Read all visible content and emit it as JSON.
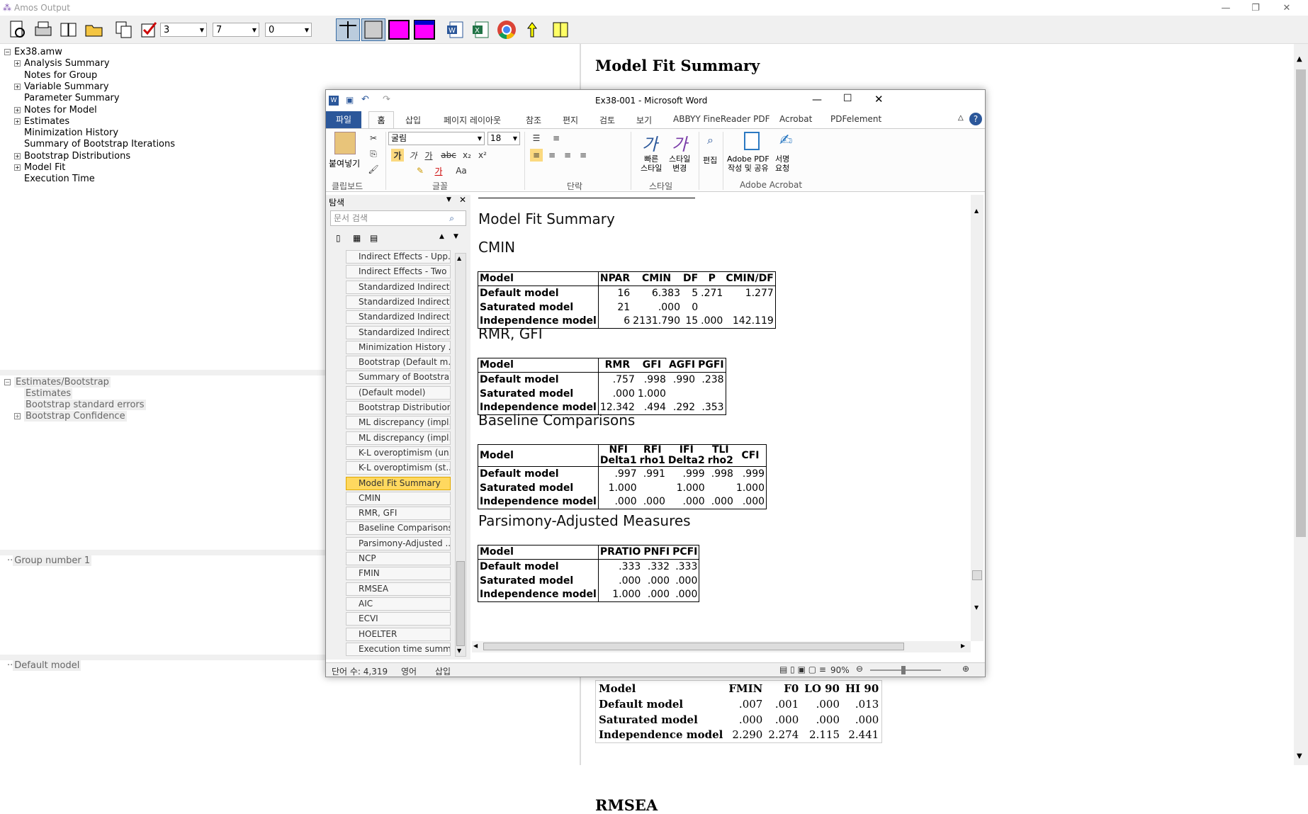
{
  "amos": {
    "title": "Amos Output",
    "window_buttons": [
      "—",
      "❐",
      "✕"
    ],
    "selects": [
      "3",
      "7",
      "0"
    ],
    "tree": [
      {
        "label": "Ex38.amw",
        "pm": "−",
        "indent": 0
      },
      {
        "label": "Analysis Summary",
        "pm": "+",
        "indent": 1
      },
      {
        "label": "Notes for Group",
        "pm": "",
        "indent": 1
      },
      {
        "label": "Variable Summary",
        "pm": "+",
        "indent": 1
      },
      {
        "label": "Parameter Summary",
        "pm": "",
        "indent": 1
      },
      {
        "label": "Notes for Model",
        "pm": "+",
        "indent": 1
      },
      {
        "label": "Estimates",
        "pm": "+",
        "indent": 1
      },
      {
        "label": "Minimization History",
        "pm": "",
        "indent": 1
      },
      {
        "label": "Summary of Bootstrap Iterations",
        "pm": "",
        "indent": 1
      },
      {
        "label": "Bootstrap Distributions",
        "pm": "+",
        "indent": 1
      },
      {
        "label": "Model Fit",
        "pm": "+",
        "indent": 1
      },
      {
        "label": "Execution Time",
        "pm": "",
        "indent": 1
      }
    ],
    "pane2": {
      "root": "Estimates/Bootstrap",
      "items": [
        "Estimates",
        "Bootstrap standard errors",
        "Bootstrap Confidence"
      ]
    },
    "pane3": "Group number 1",
    "pane4": "Default model",
    "output_heading": "Model Fit Summary",
    "output_next_heading": "RMSEA",
    "fmin_table": {
      "header": [
        "Model",
        "FMIN",
        "F0",
        "LO 90",
        "HI 90"
      ],
      "rows": [
        [
          "Default model",
          ".007",
          ".001",
          ".000",
          ".013"
        ],
        [
          "Saturated model",
          ".000",
          ".000",
          ".000",
          ".000"
        ],
        [
          "Independence model",
          "2.290",
          "2.274",
          "2.115",
          "2.441"
        ]
      ]
    }
  },
  "word": {
    "title": "Ex38-001  -  Microsoft Word",
    "tabs": [
      "파일",
      "홈",
      "삽입",
      "페이지 레이아웃",
      "참조",
      "편지",
      "검토",
      "보기",
      "ABBYY FineReader PDF",
      "Acrobat",
      "PDFelement"
    ],
    "font_name": "굴림",
    "font_size": "18",
    "groups": [
      "클립보드",
      "글꼴",
      "단락",
      "스타일",
      "Adobe Acrobat"
    ],
    "paste_label": "붙여넣기",
    "style_quick": "빠른\n스타일",
    "style_change": "스타일\n변경",
    "edit_label": "편집",
    "adobe_pdf": "Adobe PDF\n작성 및 공유",
    "sign_req": "서명\n요청",
    "nav_title": "탐색",
    "nav_search_placeholder": "문서 검색",
    "nav_items": [
      "Indirect Effects - Upp...",
      "Indirect Effects - Two ...",
      "Standardized Indirect ...",
      "Standardized Indirect ...",
      "Standardized Indirect ...",
      "Standardized Indirect ...",
      "Minimization History ...",
      "Bootstrap (Default m...",
      "Summary of Bootstra...",
      "(Default model)",
      "Bootstrap Distribution...",
      "ML discrepancy (impl...",
      "ML discrepancy (impl...",
      "K-L overoptimism (un...",
      "K-L overoptimism (st...",
      "Model Fit Summary",
      "CMIN",
      "RMR, GFI",
      "Baseline Comparisons",
      "Parsimony-Adjusted ...",
      "NCP",
      "FMIN",
      "RMSEA",
      "AIC",
      "ECVI",
      "HOELTER",
      "Execution time summ..."
    ],
    "nav_selected": 15,
    "doc": {
      "title": "Model Fit Summary",
      "cmin": {
        "heading": "CMIN",
        "header": [
          "Model",
          "NPAR",
          "CMIN",
          "DF",
          "P",
          "CMIN/DF"
        ],
        "rows": [
          [
            "Default model",
            "16",
            "6.383",
            "5",
            ".271",
            "1.277"
          ],
          [
            "Saturated model",
            "21",
            ".000",
            "0",
            "",
            ""
          ],
          [
            "Independence model",
            "6",
            "2131.790",
            "15",
            ".000",
            "142.119"
          ]
        ]
      },
      "rmr": {
        "heading": "RMR, GFI",
        "header": [
          "Model",
          "RMR",
          "GFI",
          "AGFI",
          "PGFI"
        ],
        "rows": [
          [
            "Default model",
            ".757",
            ".998",
            ".990",
            ".238"
          ],
          [
            "Saturated model",
            ".000",
            "1.000",
            "",
            ""
          ],
          [
            "Independence model",
            "12.342",
            ".494",
            ".292",
            ".353"
          ]
        ]
      },
      "baseline": {
        "heading": "Baseline Comparisons",
        "header": [
          "Model",
          "NFI\nDelta1",
          "RFI\nrho1",
          "IFI\nDelta2",
          "TLI\nrho2",
          "CFI"
        ],
        "rows": [
          [
            "Default model",
            ".997",
            ".991",
            ".999",
            ".998",
            ".999"
          ],
          [
            "Saturated model",
            "1.000",
            "",
            "1.000",
            "",
            "1.000"
          ],
          [
            "Independence model",
            ".000",
            ".000",
            ".000",
            ".000",
            ".000"
          ]
        ]
      },
      "parsimony": {
        "heading": "Parsimony-Adjusted Measures",
        "header": [
          "Model",
          "PRATIO",
          "PNFI",
          "PCFI"
        ],
        "rows": [
          [
            "Default model",
            ".333",
            ".332",
            ".333"
          ],
          [
            "Saturated model",
            ".000",
            ".000",
            ".000"
          ],
          [
            "Independence model",
            "1.000",
            ".000",
            ".000"
          ]
        ]
      }
    },
    "status": {
      "words": "단어 수: 4,319",
      "lang": "영어",
      "mode": "삽입",
      "zoom": "90%"
    }
  }
}
